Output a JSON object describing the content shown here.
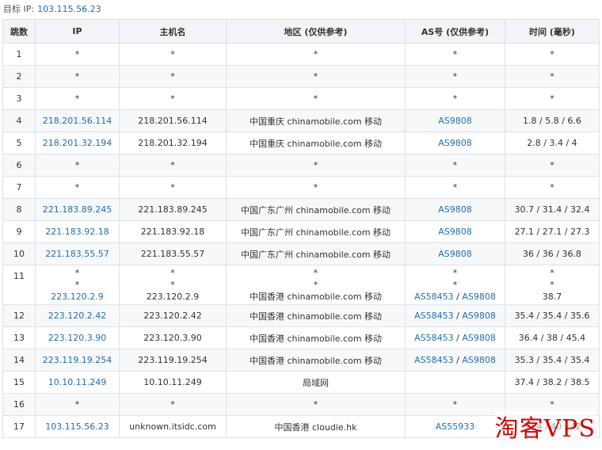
{
  "header": {
    "label": "目标 IP:",
    "ip": "103.115.56.23"
  },
  "table": {
    "columns": [
      "跳数",
      "IP",
      "主机名",
      "地区 (仅供参考)",
      "AS号 (仅供参考)",
      "时间 (毫秒)"
    ],
    "rows": [
      {
        "hop": "1",
        "ip": [
          "*"
        ],
        "host": [
          "*"
        ],
        "region": [
          "*"
        ],
        "as": [
          [
            "*"
          ]
        ],
        "time": [
          "*"
        ]
      },
      {
        "hop": "2",
        "ip": [
          "*"
        ],
        "host": [
          "*"
        ],
        "region": [
          "*"
        ],
        "as": [
          [
            "*"
          ]
        ],
        "time": [
          "*"
        ]
      },
      {
        "hop": "3",
        "ip": [
          "*"
        ],
        "host": [
          "*"
        ],
        "region": [
          "*"
        ],
        "as": [
          [
            "*"
          ]
        ],
        "time": [
          "*"
        ]
      },
      {
        "hop": "4",
        "ip": [
          "218.201.56.114"
        ],
        "host": [
          "218.201.56.114"
        ],
        "region": [
          "中国重庆 chinamobile.com 移动"
        ],
        "as": [
          [
            "AS9808"
          ]
        ],
        "time": [
          "1.8 / 5.8 / 6.6"
        ]
      },
      {
        "hop": "5",
        "ip": [
          "218.201.32.194"
        ],
        "host": [
          "218.201.32.194"
        ],
        "region": [
          "中国重庆 chinamobile.com 移动"
        ],
        "as": [
          [
            "AS9808"
          ]
        ],
        "time": [
          "2.8 / 3.4 / 4"
        ]
      },
      {
        "hop": "6",
        "ip": [
          "*"
        ],
        "host": [
          "*"
        ],
        "region": [
          "*"
        ],
        "as": [
          [
            "*"
          ]
        ],
        "time": [
          "*"
        ]
      },
      {
        "hop": "7",
        "ip": [
          "*"
        ],
        "host": [
          "*"
        ],
        "region": [
          "*"
        ],
        "as": [
          [
            "*"
          ]
        ],
        "time": [
          "*"
        ]
      },
      {
        "hop": "8",
        "ip": [
          "221.183.89.245"
        ],
        "host": [
          "221.183.89.245"
        ],
        "region": [
          "中国广东广州 chinamobile.com 移动"
        ],
        "as": [
          [
            "AS9808"
          ]
        ],
        "time": [
          "30.7 / 31.4 / 32.4"
        ]
      },
      {
        "hop": "9",
        "ip": [
          "221.183.92.18"
        ],
        "host": [
          "221.183.92.18"
        ],
        "region": [
          "中国广东广州 chinamobile.com 移动"
        ],
        "as": [
          [
            "AS9808"
          ]
        ],
        "time": [
          "27.1 / 27.1 / 27.3"
        ]
      },
      {
        "hop": "10",
        "ip": [
          "221.183.55.57"
        ],
        "host": [
          "221.183.55.57"
        ],
        "region": [
          "中国广东广州 chinamobile.com 移动"
        ],
        "as": [
          [
            "AS9808"
          ]
        ],
        "time": [
          "36 / 36 / 36.8"
        ]
      },
      {
        "hop": "11",
        "ip": [
          "*",
          "*",
          "223.120.2.9"
        ],
        "host": [
          "*",
          "*",
          "223.120.2.9"
        ],
        "region": [
          "*",
          "*",
          "中国香港 chinamobile.com 移动"
        ],
        "as": [
          [
            "*"
          ],
          [
            "*"
          ],
          [
            "AS58453",
            "AS9808"
          ]
        ],
        "time": [
          "*",
          "*",
          "38.7"
        ]
      },
      {
        "hop": "12",
        "ip": [
          "223.120.2.42"
        ],
        "host": [
          "223.120.2.42"
        ],
        "region": [
          "中国香港 chinamobile.com 移动"
        ],
        "as": [
          [
            "AS58453",
            "AS9808"
          ]
        ],
        "time": [
          "35.4 / 35.4 / 35.6"
        ]
      },
      {
        "hop": "13",
        "ip": [
          "223.120.3.90"
        ],
        "host": [
          "223.120.3.90"
        ],
        "region": [
          "中国香港 chinamobile.com 移动"
        ],
        "as": [
          [
            "AS58453",
            "AS9808"
          ]
        ],
        "time": [
          "36.4 / 38 / 45.4"
        ]
      },
      {
        "hop": "14",
        "ip": [
          "223.119.19.254"
        ],
        "host": [
          "223.119.19.254"
        ],
        "region": [
          "中国香港 chinamobile.com 移动"
        ],
        "as": [
          [
            "AS58453",
            "AS9808"
          ]
        ],
        "time": [
          "35.3 / 35.4 / 35.4"
        ]
      },
      {
        "hop": "15",
        "ip": [
          "10.10.11.249"
        ],
        "host": [
          "10.10.11.249"
        ],
        "region": [
          "局域网"
        ],
        "as": [
          []
        ],
        "time": [
          "37.4 / 38.2 / 38.5"
        ]
      },
      {
        "hop": "16",
        "ip": [
          "*"
        ],
        "host": [
          "*"
        ],
        "region": [
          "*"
        ],
        "as": [
          [
            "*"
          ]
        ],
        "time": [
          "*"
        ]
      },
      {
        "hop": "17",
        "ip": [
          "103.115.56.23"
        ],
        "host": [
          "unknown.itsidc.com"
        ],
        "region": [
          "中国香港 cloudie.hk"
        ],
        "as": [
          [
            "AS55933"
          ]
        ],
        "time": [
          "39.4 / 40 / 42"
        ]
      }
    ]
  },
  "watermark": "淘客VPS",
  "colors": {
    "link": "#1f6fb2",
    "header_bg": "#f2f4f7",
    "border": "#dde2e8",
    "watermark": "#d40000"
  }
}
